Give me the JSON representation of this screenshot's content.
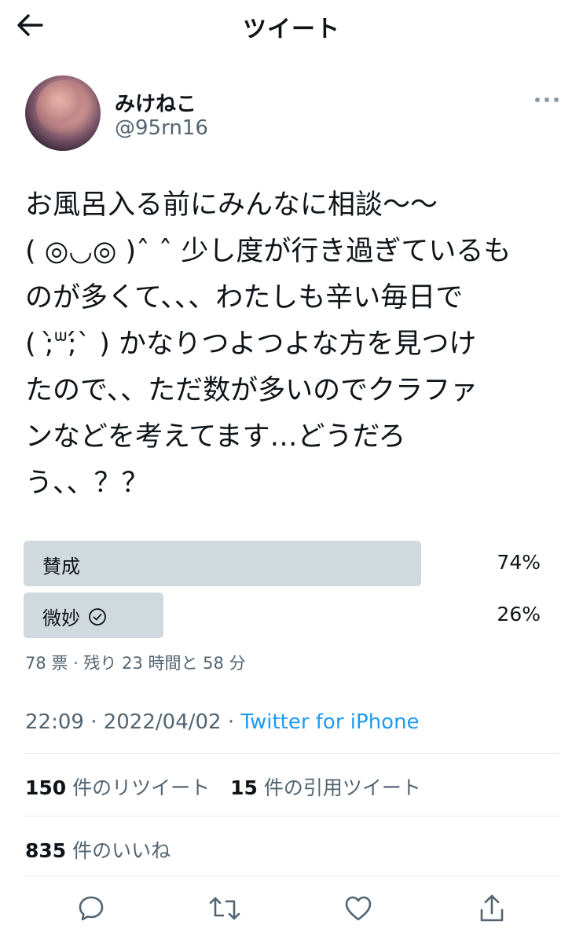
{
  "header": {
    "title": "ツイート"
  },
  "author": {
    "name": "みけねこ",
    "handle": "@95rn16"
  },
  "tweet": {
    "text": "お風呂入る前にみんなに相談〜〜\n( ◎◡◎ )ˆ ˆ 少し度が行き過ぎているも\nのが多くて、、、わたしも辛い毎日で\n( ;̀ᐜ;́` ) かなりつよつよな方を見つけ\nたので、、ただ数が多いのでクラファ\nンなどを考えてます…どうだろ\nう、、？？"
  },
  "poll": {
    "options": [
      {
        "label": "賛成",
        "percent": "74%",
        "value": 74,
        "selected": false
      },
      {
        "label": "微妙",
        "percent": "26%",
        "value": 26,
        "selected": true
      }
    ],
    "meta": "78 票 · 残り 23 時間と 58 分"
  },
  "timestamp": {
    "time": "22:09 · 2022/04/02 · ",
    "source": "Twitter for iPhone"
  },
  "stats": {
    "retweets_count": "150",
    "retweets_label": "件のリツイート",
    "quotes_count": "15",
    "quotes_label": "件の引用ツイート",
    "likes_count": "835",
    "likes_label": "件のいいね"
  },
  "colors": {
    "link": "#1d9bf0",
    "muted": "#536471",
    "poll_fill": "#cfd9de"
  },
  "icons": [
    "back-arrow-icon",
    "more-icon",
    "check-circle-icon",
    "reply-icon",
    "retweet-icon",
    "like-icon",
    "share-icon"
  ]
}
